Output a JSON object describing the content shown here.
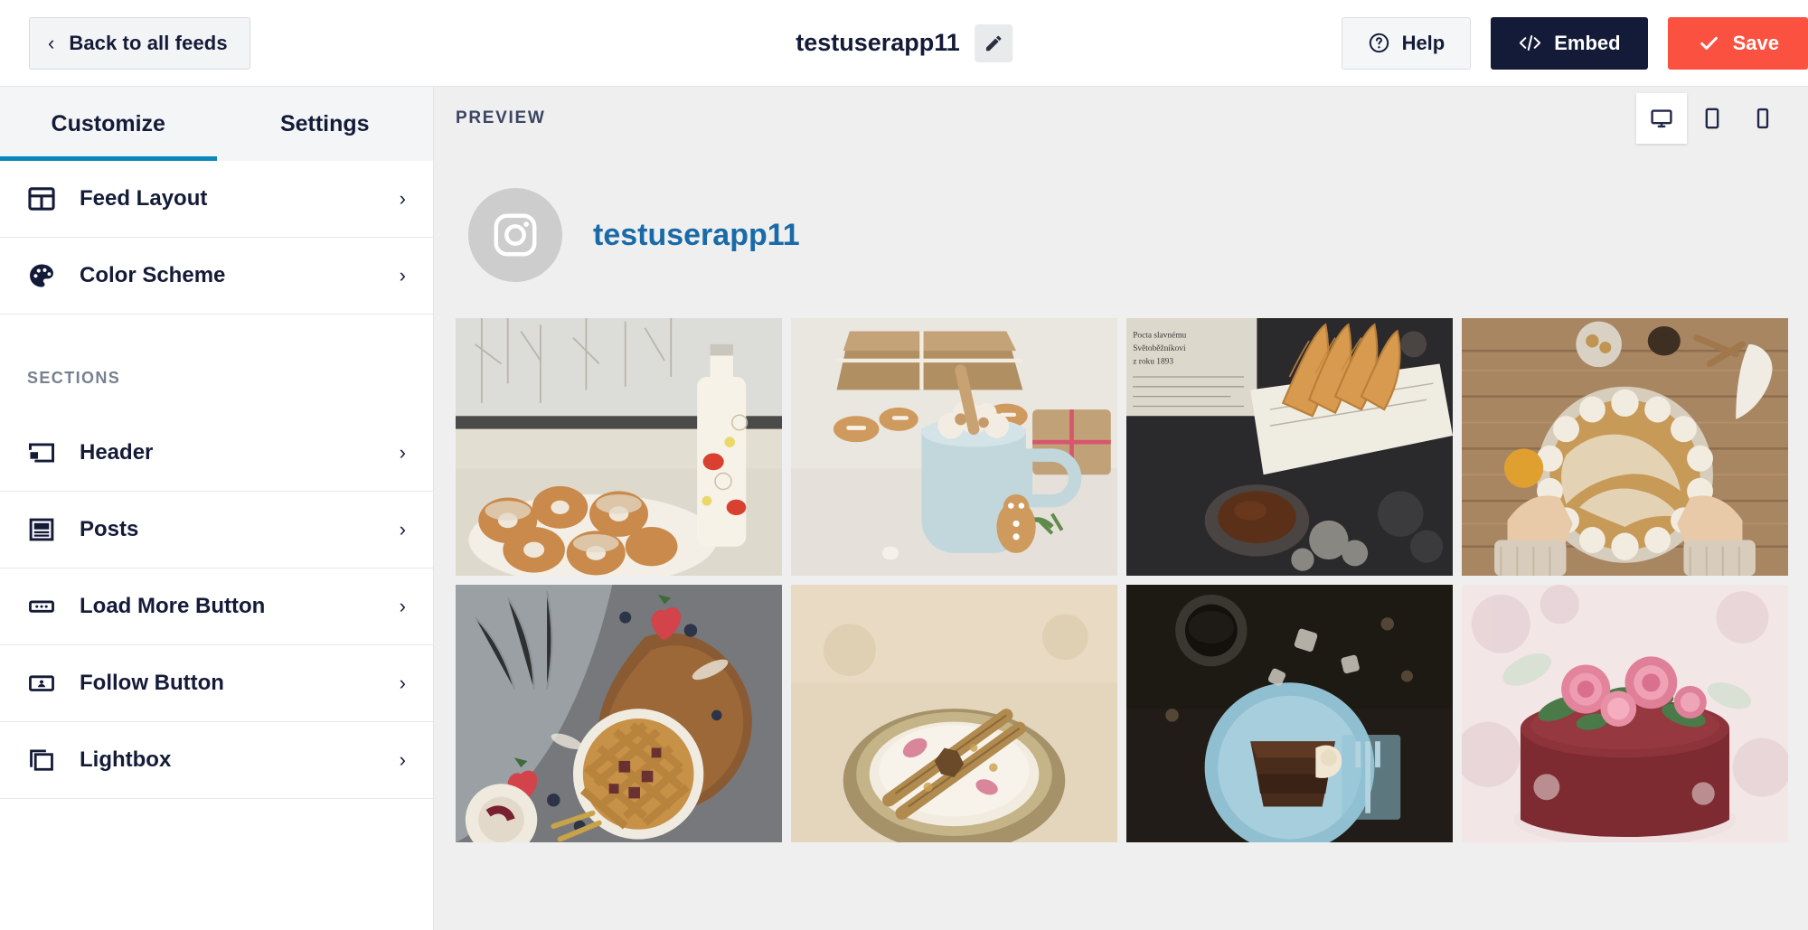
{
  "topbar": {
    "back_label": "Back to all feeds",
    "back_chevron": "chevron-left-icon",
    "title": "testuserapp11",
    "edit_icon": "pencil-icon",
    "help_label": "Help",
    "help_icon": "question-circle-icon",
    "embed_label": "Embed",
    "embed_icon": "code-icon",
    "save_label": "Save",
    "save_icon": "check-icon",
    "colors": {
      "embed_bg": "#141b38",
      "save_bg": "#fb5141",
      "help_bg": "#f5f6f7"
    }
  },
  "sidebar": {
    "tabs": [
      {
        "label": "Customize",
        "active": true
      },
      {
        "label": "Settings",
        "active": false
      }
    ],
    "active_tab_color": "#0d86bd",
    "primary_items": [
      {
        "label": "Feed Layout",
        "icon": "grid-layout-icon",
        "arrow": "›"
      },
      {
        "label": "Color Scheme",
        "icon": "palette-icon",
        "arrow": "›"
      }
    ],
    "sections_label": "SECTIONS",
    "section_items": [
      {
        "label": "Header",
        "icon": "header-block-icon",
        "arrow": "›"
      },
      {
        "label": "Posts",
        "icon": "posts-article-icon",
        "arrow": "›"
      },
      {
        "label": "Load More Button",
        "icon": "load-more-dots-icon",
        "arrow": "›"
      },
      {
        "label": "Follow Button",
        "icon": "follow-person-icon",
        "arrow": "›"
      },
      {
        "label": "Lightbox",
        "icon": "lightbox-layers-icon",
        "arrow": "›"
      }
    ]
  },
  "preview": {
    "label": "PREVIEW",
    "devices": [
      {
        "name": "desktop",
        "icon": "desktop-icon",
        "active": true
      },
      {
        "name": "tablet",
        "icon": "tablet-icon",
        "active": false
      },
      {
        "name": "mobile",
        "icon": "mobile-icon",
        "active": false
      }
    ],
    "account": {
      "avatar_icon": "instagram-icon",
      "username": "testuserapp11",
      "username_color": "#1a6aa8"
    },
    "grid": {
      "columns": 4,
      "rows": 2,
      "photos": [
        {
          "alt": "Powdered sugar donuts on tray by snowy window with milk bottle",
          "theme": "donuts"
        },
        {
          "alt": "Hot chocolate mug with marshmallows and gingerbread man",
          "theme": "cocoa"
        },
        {
          "alt": "Churros in newspaper wrap with chocolate dipping sauce",
          "theme": "churros"
        },
        {
          "alt": "Meringue topped pie held by hands on wooden table",
          "theme": "pie-wood"
        },
        {
          "alt": "Lattice berry pie on wooden board with strawberries",
          "theme": "lattice-pie"
        },
        {
          "alt": "Creamy drink in ceramic cup with cinnamon sticks and star anise",
          "theme": "cinnamon-cup"
        },
        {
          "alt": "Chocolate cake slice on blue plate with fork and coffee",
          "theme": "choc-slice"
        },
        {
          "alt": "Red velvet cake decorated with pink roses",
          "theme": "rose-cake"
        }
      ]
    }
  }
}
